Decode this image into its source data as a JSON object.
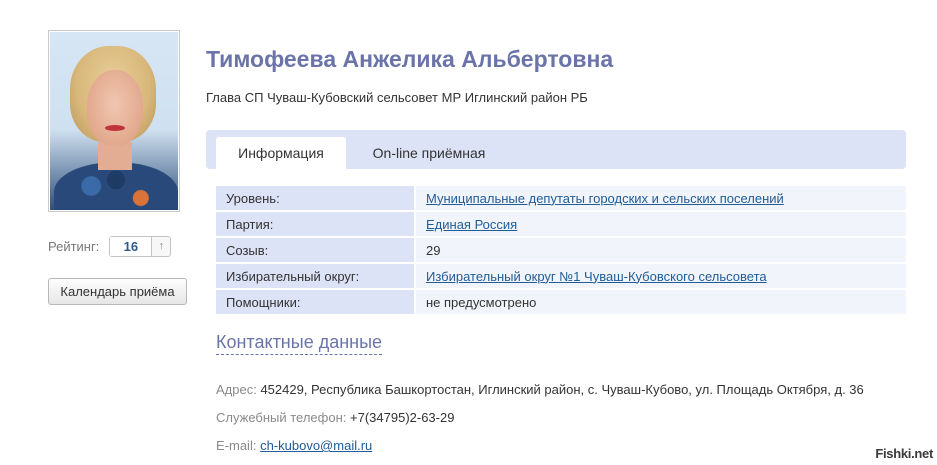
{
  "profile": {
    "name": "Тимофеева Анжелика Альбертовна",
    "position": "Глава СП Чуваш-Кубовский сельсовет МР Иглинский район РБ"
  },
  "rating": {
    "label": "Рейтинг:",
    "value": "16",
    "up_icon": "arrow-up-icon",
    "up_glyph": "↑"
  },
  "calendar_button": "Календарь приёма",
  "tabs": [
    {
      "label": "Информация",
      "active": true
    },
    {
      "label": "On-line приёмная",
      "active": false
    }
  ],
  "info": [
    {
      "label": "Уровень:",
      "value": "Муниципальные депутаты городских и сельских поселений",
      "link": true
    },
    {
      "label": "Партия:",
      "value": "Единая Россия",
      "link": true
    },
    {
      "label": "Созыв:",
      "value": "29",
      "link": false
    },
    {
      "label": "Избирательный округ:",
      "value": "Избирательный округ №1 Чуваш-Кубовского сельсовета",
      "link": true
    },
    {
      "label": "Помощники:",
      "value": "не предусмотрено",
      "link": false
    }
  ],
  "contacts": {
    "heading": "Контактные данные",
    "address_label": "Адрес:",
    "address": "452429, Республика Башкортостан, Иглинский район, с. Чуваш-Кубово, ул. Площадь Октября, д. 36",
    "phone_label": "Служебный телефон:",
    "phone": "+7(34795)2-63-29",
    "email_label": "E-mail:",
    "email": "ch-kubovo@mail.ru"
  },
  "watermark": "Fishki.net",
  "colors": {
    "accent": "#6b74a8",
    "link": "#1f5c98",
    "tab_bar": "#dde3f7"
  }
}
